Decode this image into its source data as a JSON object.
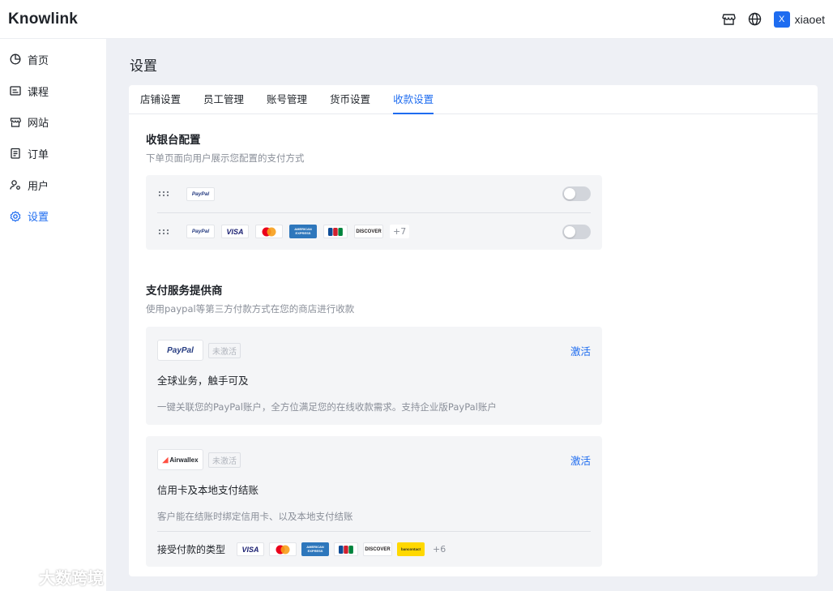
{
  "app": {
    "logo": "Knowlink"
  },
  "header": {
    "user_initial": "X",
    "user_name": "xiaoet",
    "icons": [
      "store-icon",
      "globe-icon"
    ]
  },
  "sidebar": {
    "items": [
      {
        "label": "首页",
        "icon": "dashboard-icon",
        "active": false
      },
      {
        "label": "课程",
        "icon": "course-icon",
        "active": false
      },
      {
        "label": "网站",
        "icon": "website-icon",
        "active": false
      },
      {
        "label": "订单",
        "icon": "order-icon",
        "active": false
      },
      {
        "label": "用户",
        "icon": "user-icon",
        "active": false
      },
      {
        "label": "设置",
        "icon": "settings-icon",
        "active": true
      }
    ]
  },
  "page": {
    "title": "设置"
  },
  "tabs": [
    {
      "label": "店铺设置",
      "active": false
    },
    {
      "label": "员工管理",
      "active": false
    },
    {
      "label": "账号管理",
      "active": false
    },
    {
      "label": "货币设置",
      "active": false
    },
    {
      "label": "收款设置",
      "active": true
    }
  ],
  "checkout": {
    "title": "收银台配置",
    "desc": "下单页面向用户展示您配置的支付方式",
    "rows": [
      {
        "logos": [
          "PayPal"
        ],
        "enabled": false
      },
      {
        "logos": [
          "PayPal",
          "VISA",
          "Mastercard",
          "AMERICAN EXPRESS",
          "JCB",
          "DISCOVER"
        ],
        "more": "+7",
        "enabled": false
      }
    ]
  },
  "providers": {
    "title": "支付服务提供商",
    "desc": "使用paypal等第三方付款方式在您的商店进行收款",
    "items": [
      {
        "logo": "PayPal",
        "status": "未激活",
        "action": "激活",
        "headline": "全球业务，触手可及",
        "desc": "一键关联您的PayPal账户，全方位满足您的在线收款需求。支持企业版PayPal账户"
      },
      {
        "logo": "Airwallex",
        "status": "未激活",
        "action": "激活",
        "headline": "信用卡及本地支付结账",
        "desc": "客户能在结账时绑定信用卡、以及本地支付结账",
        "accept_label": "接受付款的类型",
        "accept_logos": [
          "VISA",
          "Mastercard",
          "AMERICAN EXPRESS",
          "JCB",
          "DISCOVER",
          "bancontact"
        ],
        "accept_more": "+6"
      }
    ]
  },
  "watermark": {
    "text": "大数跨境"
  },
  "colors": {
    "accent": "#1e6cf0",
    "muted": "#8a8f99",
    "panel": "#f4f5f7",
    "background": "#eef0f5"
  }
}
